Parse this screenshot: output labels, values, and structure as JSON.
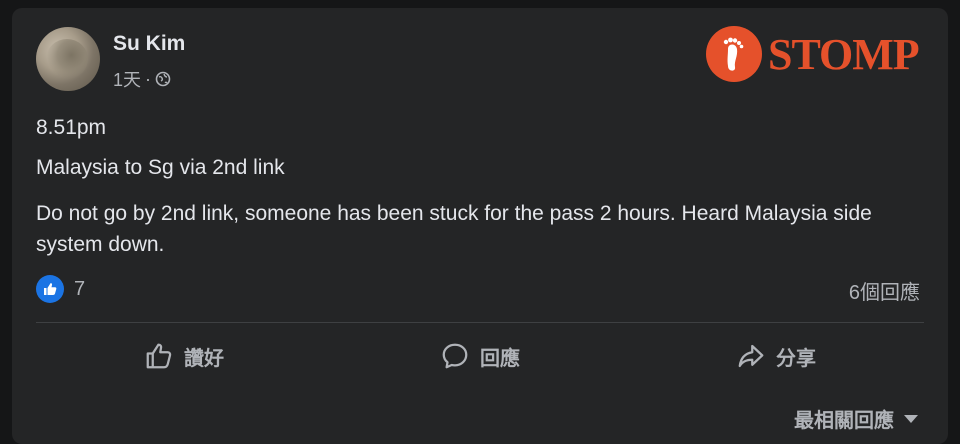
{
  "post": {
    "author": "Su Kim",
    "time": "1天",
    "separator": "·",
    "privacy_icon": "globe-icon",
    "lines": {
      "time_text": "8.51pm",
      "route": "Malaysia to Sg via 2nd link",
      "message": "Do not go by 2nd link, someone has been stuck for the pass 2 hours. Heard Malaysia side system down."
    }
  },
  "watermark": {
    "text": "STOMP",
    "color": "#e5512b"
  },
  "reactions": {
    "icon": "like-badge-icon",
    "count": "7"
  },
  "comments_count": "6個回應",
  "actions": {
    "like": "讚好",
    "comment": "回應",
    "share": "分享"
  },
  "sort": {
    "label": "最相關回應"
  },
  "colors": {
    "background": "#151617",
    "card": "#242526",
    "text": "#e4e6eb",
    "secondary": "#b0b3b8",
    "like_blue": "#1b74e4"
  }
}
